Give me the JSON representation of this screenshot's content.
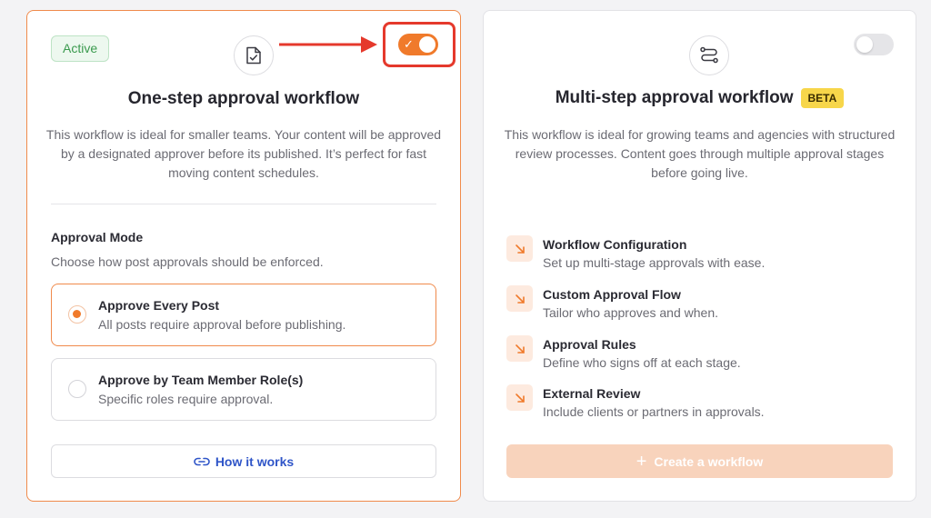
{
  "one_step": {
    "status_badge": "Active",
    "title": "One-step approval workflow",
    "description": "This workflow is ideal for smaller teams. Your content will be approved by a designated approver before its published. It’s perfect for fast moving content schedules.",
    "toggle_enabled": true,
    "approval_mode": {
      "heading": "Approval Mode",
      "subheading": "Choose how post approvals should be enforced.",
      "options": [
        {
          "title": "Approve Every Post",
          "subtitle": "All posts require approval before publishing.",
          "selected": true
        },
        {
          "title": "Approve by Team Member Role(s)",
          "subtitle": "Specific roles require approval.",
          "selected": false
        }
      ]
    },
    "how_it_works_label": "How it works"
  },
  "multi_step": {
    "title": "Multi-step approval workflow",
    "beta_badge": "BETA",
    "description": "This workflow is ideal for growing teams and agencies with structured review processes. Content goes through multiple approval stages before going live.",
    "toggle_enabled": false,
    "features": [
      {
        "title": "Workflow Configuration",
        "subtitle": "Set up multi-stage approvals with ease."
      },
      {
        "title": "Custom Approval Flow",
        "subtitle": "Tailor who approves and when."
      },
      {
        "title": "Approval Rules",
        "subtitle": "Define who signs off at each stage."
      },
      {
        "title": "External Review",
        "subtitle": "Include clients or partners in approvals."
      }
    ],
    "create_label": "Create a workflow"
  },
  "colors": {
    "accent": "#f07a2b",
    "highlight": "#e5392c",
    "link": "#2f55c8",
    "beta": "#f7d64a",
    "active_green": "#3a9a4e"
  },
  "icons": {
    "one_step": "document-check-icon",
    "multi_step": "workflow-route-icon",
    "feature": "arrow-down-right-icon",
    "how_it_works": "link-icon",
    "create": "plus-icon",
    "annotation": "red-arrow-icon"
  }
}
